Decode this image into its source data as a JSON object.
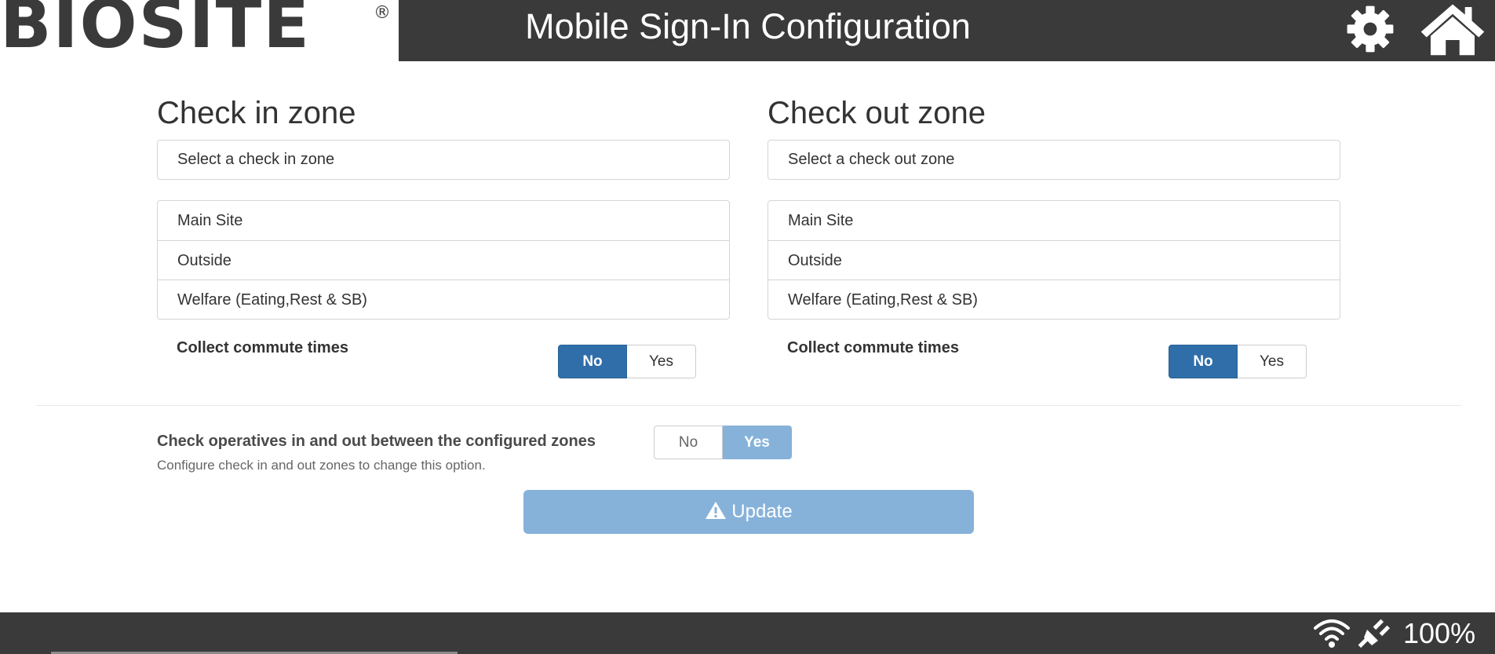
{
  "header": {
    "logo_text": "BIOSITE",
    "logo_mark": "®",
    "title": "Mobile Sign-In Configuration",
    "icons": [
      "gear-icon",
      "home-icon"
    ]
  },
  "check_in": {
    "heading": "Check in zone",
    "select_placeholder": "Select a check in zone",
    "items": [
      "Main Site",
      "Outside",
      "Welfare (Eating,Rest & SB)"
    ],
    "commute_label": "Collect commute times",
    "toggle": {
      "no": "No",
      "yes": "Yes",
      "selected": "No"
    }
  },
  "check_out": {
    "heading": "Check out zone",
    "select_placeholder": "Select a check out zone",
    "items": [
      "Main Site",
      "Outside",
      "Welfare (Eating,Rest & SB)"
    ],
    "commute_label": "Collect commute times",
    "toggle": {
      "no": "No",
      "yes": "Yes",
      "selected": "No"
    }
  },
  "between_zones": {
    "label": "Check operatives in and out between the configured zones",
    "toggle": {
      "no": "No",
      "yes": "Yes",
      "selected": "Yes",
      "disabled": true
    },
    "hint": "Configure check in and out zones to change this option."
  },
  "update_button": {
    "label": "Update",
    "icon": "warning-icon",
    "disabled": true
  },
  "status_bar": {
    "icons": [
      "wifi-icon",
      "plug-icon"
    ],
    "battery": "100%"
  },
  "colors": {
    "header_bg": "#3b3a3a",
    "active_toggle": "#2f6ea9",
    "disabled_accent": "#86b2da"
  }
}
